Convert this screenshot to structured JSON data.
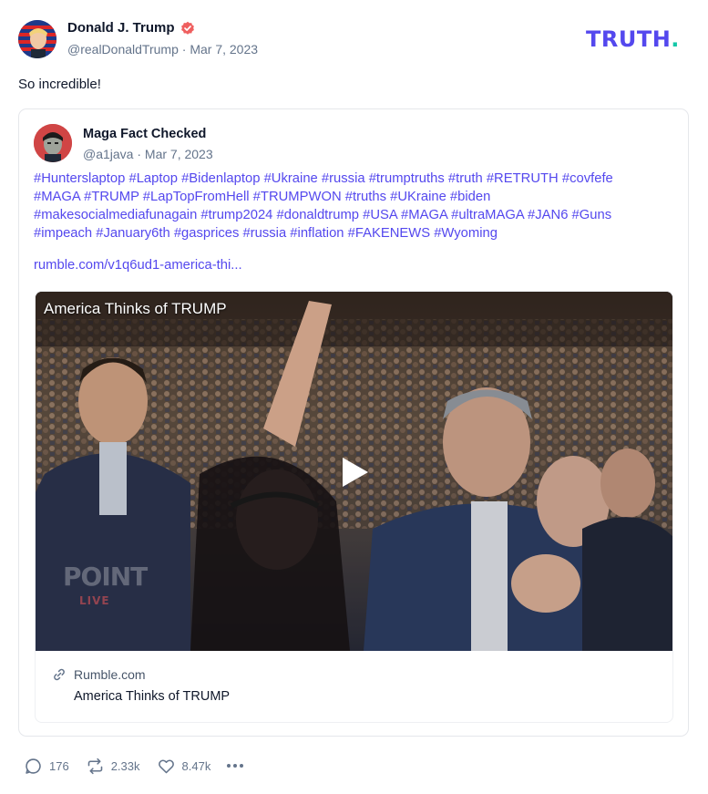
{
  "post": {
    "author": {
      "name": "Donald J. Trump",
      "handle": "@realDonaldTrump",
      "date": "Mar 7, 2023",
      "verified_icon": "verified-badge-icon"
    },
    "brand": {
      "logo_text": "TRUTH",
      "logo_dot": ".",
      "colors": {
        "purple": "#5448ee",
        "teal": "#14c7a8"
      }
    },
    "text": "So incredible!",
    "quote": {
      "name": "Maga Fact Checked",
      "handle": "@a1java",
      "date": "Mar 7, 2023",
      "tags_lines": [
        "#Hunterslaptop #Laptop #Bidenlaptop #Ukraine  #russia #trumptruths #truth #RETRUTH #covfefe",
        "#MAGA #TRUMP #LapTopFromHell #TRUMPWON #truths #UKraine #biden",
        "#makesocialmediafunagain #trump2024 #donaldtrump #USA #MAGA  #ultraMAGA #JAN6 #Guns",
        "#impeach #January6th  #gasprices #russia #inflation #FAKENEWS #Wyoming"
      ],
      "link": "rumble.com/v1q6ud1-america-thi...",
      "card": {
        "video_title": "America Thinks of TRUMP",
        "watermark_line1": "POINT",
        "watermark_line2": "LIVE",
        "domain": "Rumble.com",
        "title": "America Thinks of TRUMP"
      }
    },
    "actions": {
      "replies": "176",
      "retruths": "2.33k",
      "likes": "8.47k"
    }
  }
}
